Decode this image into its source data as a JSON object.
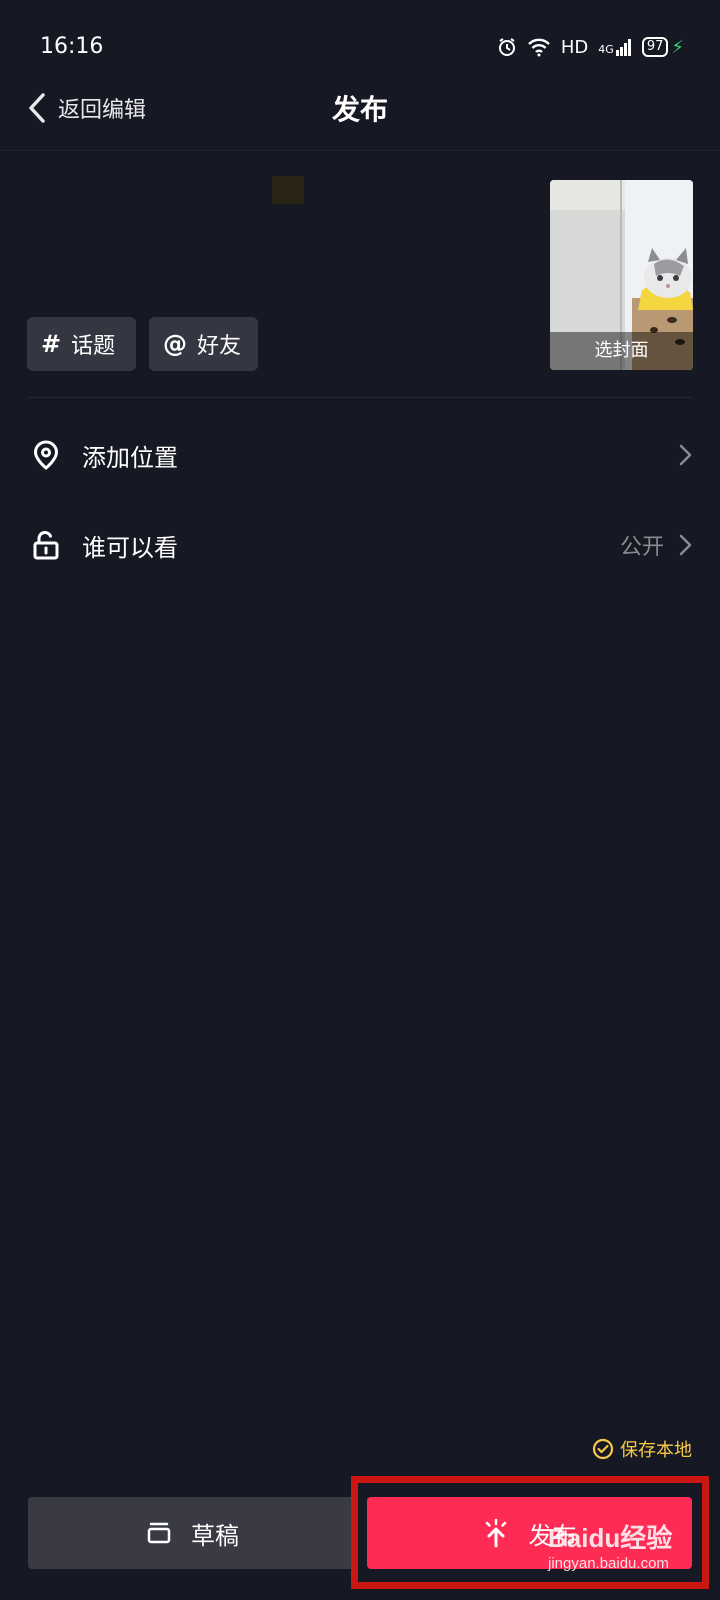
{
  "status_bar": {
    "time": "16:16",
    "network_label": "HD",
    "signal_label": "4G",
    "battery_level": "97"
  },
  "header": {
    "back_label": "返回编辑",
    "title": "发布"
  },
  "composer": {
    "chips": [
      {
        "symbol": "#",
        "label": "话题"
      },
      {
        "symbol": "@",
        "label": "好友"
      }
    ],
    "cover_label": "选封面"
  },
  "settings": {
    "location_label": "添加位置",
    "visibility_label": "谁可以看",
    "visibility_value": "公开"
  },
  "footer": {
    "save_local_label": "保存本地",
    "draft_label": "草稿",
    "publish_label": "发布"
  },
  "watermark": {
    "logo_text": "Baidu经验",
    "url": "jingyan.baidu.com"
  },
  "colors": {
    "background": "#161823",
    "publish": "#fe2c55",
    "save_local": "#f7c948",
    "highlight_box": "#cc1612"
  }
}
